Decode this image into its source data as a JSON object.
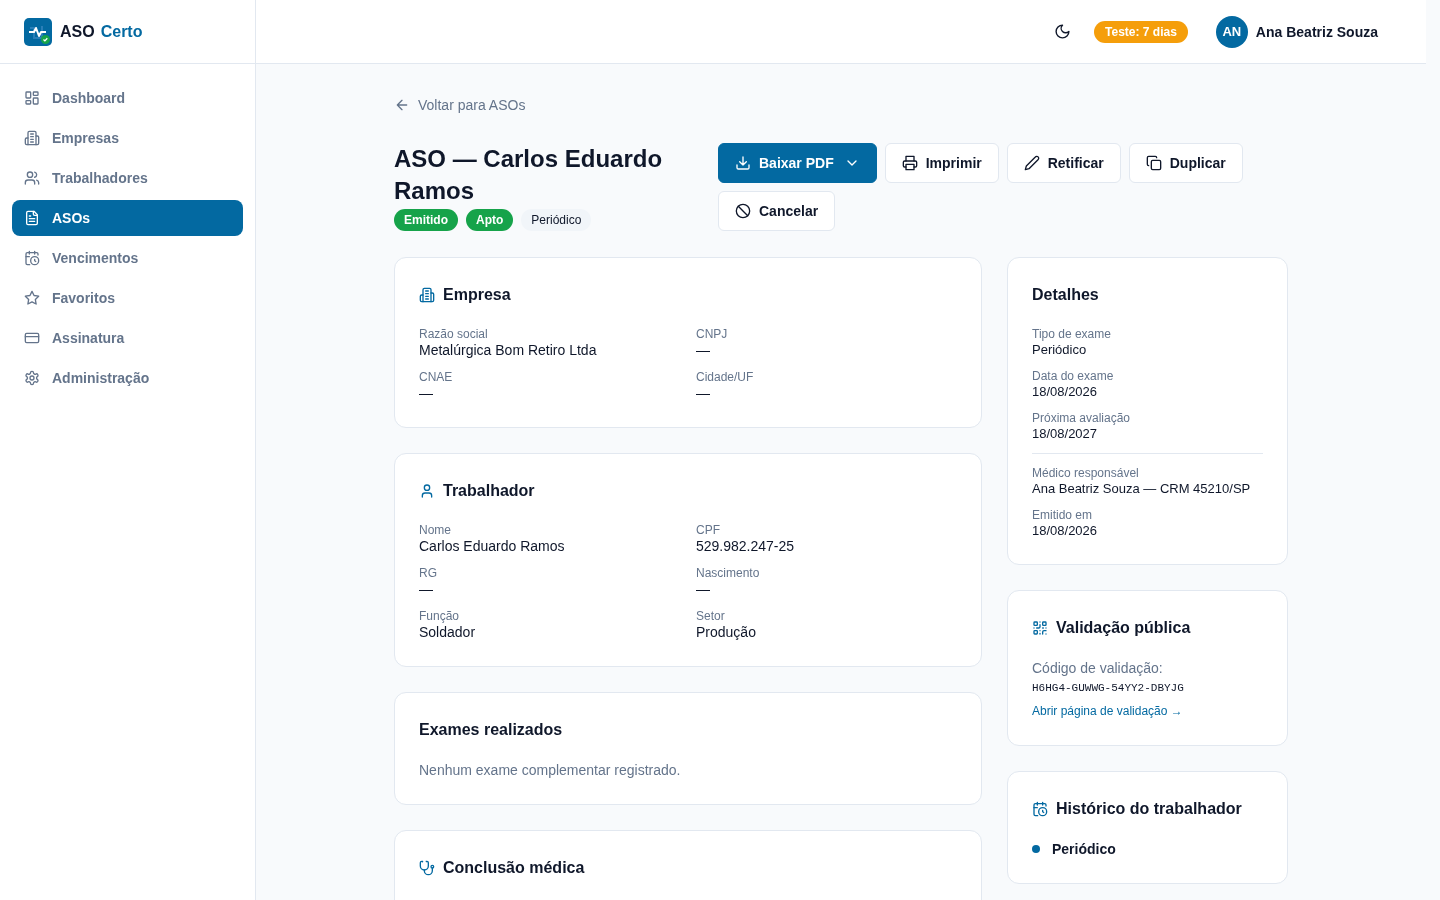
{
  "app": {
    "logo_text": "ASO",
    "logo_accent": "Certo"
  },
  "sidebar": {
    "items": [
      {
        "label": "Dashboard",
        "selected": false
      },
      {
        "label": "Empresas",
        "selected": false
      },
      {
        "label": "Trabalhadores",
        "selected": false
      },
      {
        "label": "ASOs",
        "selected": true
      },
      {
        "label": "Vencimentos",
        "selected": false
      },
      {
        "label": "Favoritos",
        "selected": false
      },
      {
        "label": "Assinatura",
        "selected": false
      },
      {
        "label": "Administração",
        "selected": false
      }
    ]
  },
  "header": {
    "trial_badge": "Teste: 7 dias",
    "user": {
      "initials": "AN",
      "name": "Ana Beatriz Souza"
    }
  },
  "back_link": "Voltar para ASOs",
  "title": "ASO — Carlos Eduardo Ramos",
  "badges": [
    {
      "label": "Emitido",
      "kind": "success"
    },
    {
      "label": "Apto",
      "kind": "success"
    },
    {
      "label": "Periódico",
      "kind": "neutral"
    }
  ],
  "actions": [
    {
      "label": "Baixar PDF",
      "kind": "primary",
      "dropdown": true
    },
    {
      "label": "Imprimir",
      "kind": "outline",
      "dropdown": false
    },
    {
      "label": "Retificar",
      "kind": "outline",
      "dropdown": false
    },
    {
      "label": "Duplicar",
      "kind": "outline",
      "dropdown": false
    },
    {
      "label": "Cancelar",
      "kind": "outline",
      "dropdown": false
    }
  ],
  "sections": [
    {
      "title": "Empresa",
      "fields": [
        {
          "label": "Razão social",
          "value": "Metalúrgica Bom Retiro Ltda"
        },
        {
          "label": "CNPJ",
          "value": "—"
        },
        {
          "label": "CNAE",
          "value": "—"
        },
        {
          "label": "Cidade/UF",
          "value": "—"
        }
      ]
    },
    {
      "title": "Trabalhador",
      "fields": [
        {
          "label": "Nome",
          "value": "Carlos Eduardo Ramos"
        },
        {
          "label": "CPF",
          "value": "529.982.247-25"
        },
        {
          "label": "RG",
          "value": "—"
        },
        {
          "label": "Nascimento",
          "value": "—"
        },
        {
          "label": "Função",
          "value": "Soldador"
        },
        {
          "label": "Setor",
          "value": "Produção"
        }
      ]
    },
    {
      "title": "Exames realizados",
      "empty_text": "Nenhum exame complementar registrado."
    },
    {
      "title": "Conclusão médica"
    }
  ],
  "details": {
    "title": "Detalhes",
    "groups": [
      [
        {
          "label": "Tipo de exame",
          "value": "Periódico"
        },
        {
          "label": "Data do exame",
          "value": "18/08/2026"
        },
        {
          "label": "Próxima avaliação",
          "value": "18/08/2027"
        }
      ],
      [
        {
          "label": "Médico responsável",
          "value": "Ana Beatriz Souza — CRM 45210/SP"
        },
        {
          "label": "Emitido em",
          "value": "18/08/2026"
        }
      ]
    ]
  },
  "validation": {
    "title": "Validação pública",
    "code_label": "Código de validação:",
    "code": "H6HG4-GUWWG-54YY2-DBYJG",
    "link": "Abrir página de validação →"
  },
  "history": {
    "title": "Histórico do trabalhador",
    "items": [
      {
        "label": "Periódico"
      }
    ]
  }
}
